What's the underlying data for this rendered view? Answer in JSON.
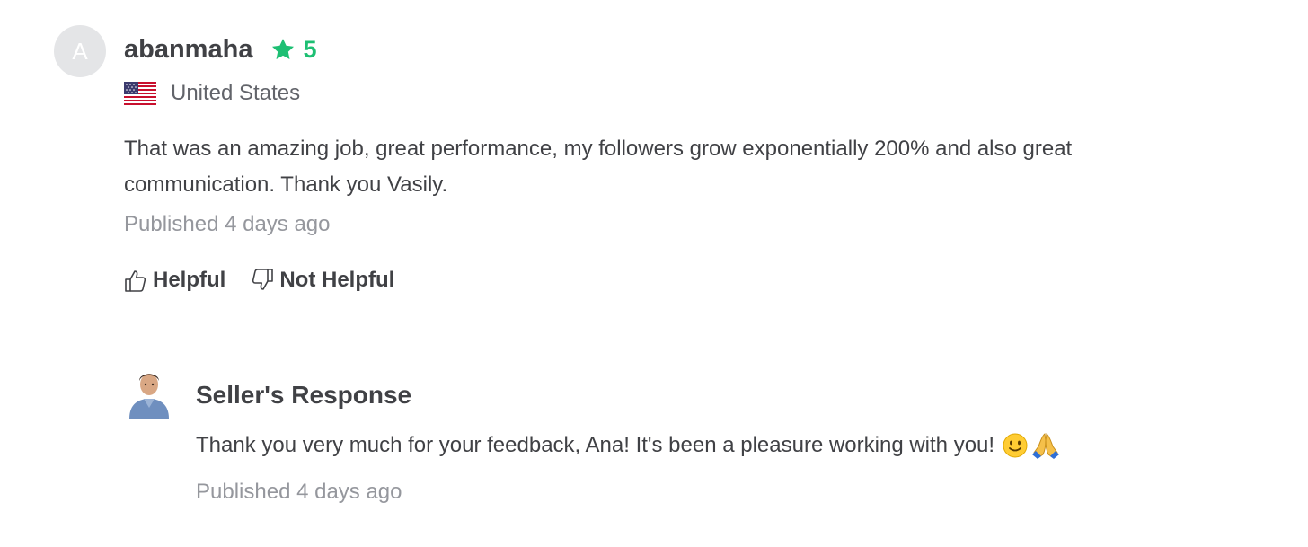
{
  "review": {
    "avatar_letter": "A",
    "username": "abanmaha",
    "rating": "5",
    "country": "United States",
    "flag_icon": "us-flag-icon",
    "comment": "That was an amazing job, great performance, my followers grow exponentially 200% and also great communication. Thank you Vasily.",
    "published": "Published 4 days ago",
    "helpful_label": "Helpful",
    "not_helpful_label": "Not Helpful"
  },
  "response": {
    "title": "Seller's Response",
    "text": "Thank you very much for your feedback, Ana! It's been a pleasure working with you!",
    "published": "Published 4 days ago"
  },
  "colors": {
    "accent_green": "#1dbf73",
    "text_primary": "#404145",
    "text_secondary": "#62646a",
    "text_muted": "#95979d",
    "avatar_bg": "#e4e5e7"
  }
}
